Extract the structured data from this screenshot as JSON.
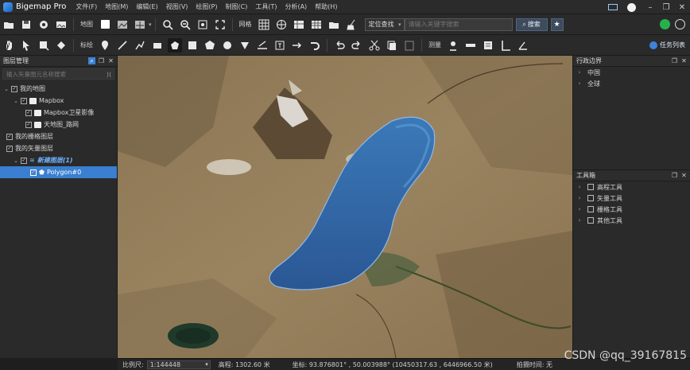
{
  "app": {
    "title": "Bigemap Pro"
  },
  "menu": [
    "文件(F)",
    "地图(M)",
    "编辑(E)",
    "视图(V)",
    "绘图(P)",
    "制图(C)",
    "工具(T)",
    "分析(A)",
    "帮助(H)"
  ],
  "toolbar1": {
    "map_label": "地图",
    "grid_label": "网格",
    "locate_select": "定位查找",
    "keyword_placeholder": "请输入关键字搜索",
    "search_label": "搜索"
  },
  "toolbar2": {
    "mark_label": "标绘",
    "measure_label": "测量",
    "task_list_label": "任务列表"
  },
  "layer_panel": {
    "title": "图层管理",
    "search_placeholder": "输入矢量图元名称搜索",
    "items": [
      {
        "label": "我的地图"
      },
      {
        "label": "Mapbox"
      },
      {
        "label": "Mapbox卫星影像"
      },
      {
        "label": "天地图_路网"
      },
      {
        "label": "我的栅格图层"
      },
      {
        "label": "我的矢量图层"
      },
      {
        "label": "新建图层(1)"
      },
      {
        "label": "Polygon#0"
      }
    ]
  },
  "admin_panel": {
    "title": "行政边界",
    "items": [
      {
        "label": "中国"
      },
      {
        "label": "全球"
      }
    ]
  },
  "toolbox_panel": {
    "title": "工具箱",
    "items": [
      {
        "label": "高程工具"
      },
      {
        "label": "矢量工具"
      },
      {
        "label": "栅格工具"
      },
      {
        "label": "其他工具"
      }
    ]
  },
  "status": {
    "scale_label": "比例尺:",
    "scale_value": "1:144448",
    "elevation": "高程:  1302.60 米",
    "coords": "坐标: 93.876801° , 50.003988°  (10450317.63 , 6446966.50 米)",
    "capture_time": "拍摄时间:  无"
  },
  "watermark": "CSDN @qq_39167815",
  "colors": {
    "accent": "#3a7fd0",
    "lake": "#2f5f9e",
    "terrain": "#8b7553"
  }
}
